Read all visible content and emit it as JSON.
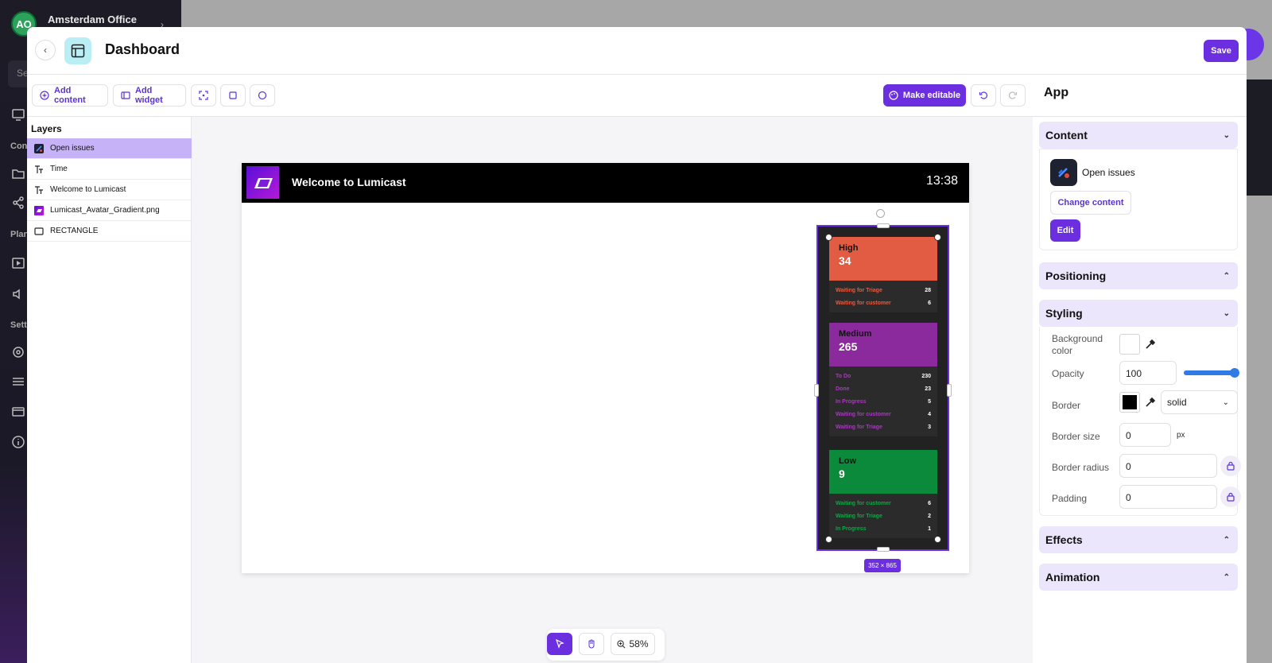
{
  "background_app": {
    "avatar_initials": "AO",
    "org_name": "Amsterdam Office",
    "search_placeholder": "Se",
    "section_labels": [
      "Con",
      "Plan",
      "Sett"
    ]
  },
  "header": {
    "back_icon": "chevron-left-icon",
    "title": "Dashboard",
    "save_label": "Save"
  },
  "toolbar": {
    "add_content": "Add content",
    "add_widget": "Add widget",
    "make_editable": "Make editable"
  },
  "layers": {
    "title": "Layers",
    "items": [
      {
        "label": "Open issues",
        "icon": "jira-app-icon",
        "selected": true
      },
      {
        "label": "Time",
        "icon": "text-icon",
        "selected": false
      },
      {
        "label": "Welcome to Lumicast",
        "icon": "text-icon",
        "selected": false
      },
      {
        "label": "Lumicast_Avatar_Gradient.png",
        "icon": "image-icon",
        "selected": false
      },
      {
        "label": "RECTANGLE",
        "icon": "rectangle-icon",
        "selected": false
      }
    ]
  },
  "stage": {
    "welcome_text": "Welcome to Lumicast",
    "time": "13:38",
    "size_badge": "352 × 865",
    "widget": {
      "priorities": [
        {
          "label": "High",
          "value": "34",
          "color": "#e25c43",
          "stat_color": "#e25c43",
          "stats": [
            {
              "label": "Waiting for Triage",
              "value": "28"
            },
            {
              "label": "Waiting for customer",
              "value": "6"
            }
          ]
        },
        {
          "label": "Medium",
          "value": "265",
          "color": "#8a2a9c",
          "stat_color": "#a43bb8",
          "stats": [
            {
              "label": "To Do",
              "value": "230"
            },
            {
              "label": "Done",
              "value": "23"
            },
            {
              "label": "In Progress",
              "value": "5"
            },
            {
              "label": "Waiting for customer",
              "value": "4"
            },
            {
              "label": "Waiting for Triage",
              "value": "3"
            }
          ]
        },
        {
          "label": "Low",
          "value": "9",
          "color": "#0a8a3a",
          "stat_color": "#12a347",
          "stats": [
            {
              "label": "Waiting for customer",
              "value": "6"
            },
            {
              "label": "Waiting for Triage",
              "value": "2"
            },
            {
              "label": "In Progress",
              "value": "1"
            }
          ]
        }
      ]
    }
  },
  "bottom_toolbar": {
    "zoom": "58%"
  },
  "right_panel": {
    "title": "App",
    "content": {
      "section": "Content",
      "app_name": "Open issues",
      "change_content": "Change content",
      "edit": "Edit"
    },
    "positioning": "Positioning",
    "styling": {
      "section": "Styling",
      "background_color_label": "Background color",
      "opacity_label": "Opacity",
      "opacity_value": "100",
      "border_label": "Border",
      "border_style": "solid",
      "border_size_label": "Border size",
      "border_size_value": "0",
      "border_size_unit": "px",
      "border_radius_label": "Border radius",
      "border_radius_value": "0",
      "padding_label": "Padding",
      "padding_value": "0",
      "opacity_level": 1.0
    },
    "effects": "Effects",
    "animation": "Animation"
  },
  "colors": {
    "accent": "#6b2fe0",
    "selected_layer": "#c6b3f7",
    "section_bg": "#ebe6fb"
  }
}
